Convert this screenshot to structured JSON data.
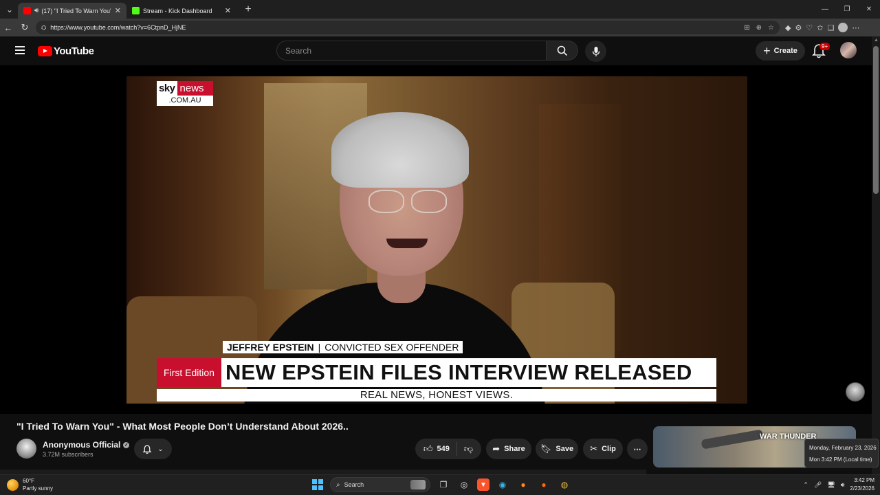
{
  "browser": {
    "tabs": [
      {
        "title": "(17) \"I Tried To Warn You\" - W",
        "active": true,
        "favicon_color": "#ff0000"
      },
      {
        "title": "Stream - Kick Dashboard",
        "active": false,
        "favicon_color": "#53fc18"
      }
    ],
    "url": "https://www.youtube.com/watch?v=6CtpnD_HjNE"
  },
  "youtube": {
    "logo_text": "YouTube",
    "search_placeholder": "Search",
    "create_label": "Create",
    "notification_count": "9+"
  },
  "video": {
    "overlay": {
      "sky_logo_sky": "sky",
      "sky_logo_news": "news",
      "sky_logo_domain": ".COM.AU",
      "name": "JEFFREY EPSTEIN",
      "descriptor": "CONVICTED SEX OFFENDER",
      "edition": "First Edition",
      "headline": "NEW EPSTEIN FILES INTERVIEW RELEASED",
      "tagline": "REAL NEWS, HONEST VIEWS."
    },
    "title": "\"I Tried To Warn You\" - What Most People Don’t Understand About 2026..",
    "channel_name": "Anonymous Official",
    "subscribers": "3.72M subscribers",
    "like_count": "549",
    "share_label": "Share",
    "save_label": "Save",
    "clip_label": "Clip"
  },
  "recommendation": {
    "game_logo": "WAR THUNDER"
  },
  "tooltip": {
    "date": "Monday, February 23, 2026",
    "time_local": "Mon 3:42 PM (Local time)"
  },
  "taskbar": {
    "weather_temp": "60°F",
    "weather_desc": "Partly sunny",
    "search_label": "Search",
    "clock_time": "3:42 PM",
    "clock_date": "2/23/2026"
  },
  "colors": {
    "yt_red": "#ff0000",
    "sky_red": "#c8102e",
    "bg": "#0f0f0f"
  }
}
